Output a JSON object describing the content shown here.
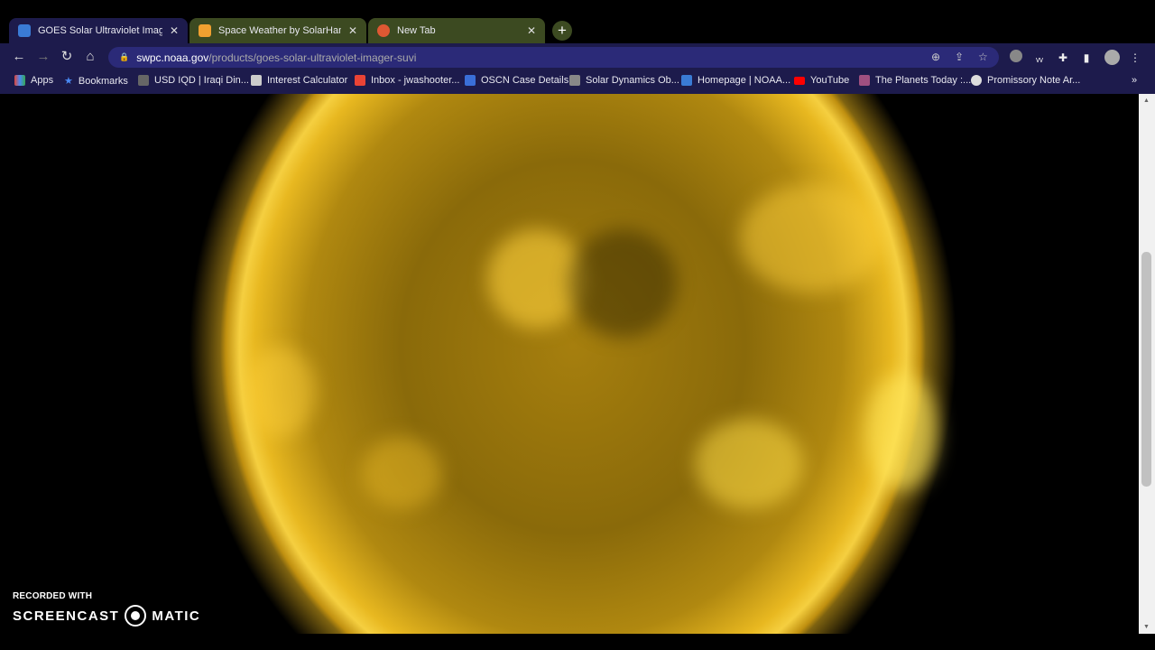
{
  "tabs": [
    {
      "title": "GOES Solar Ultraviolet Imager (S",
      "favicon": "noaa-icon",
      "color": "#3a7bd5",
      "active": true
    },
    {
      "title": "Space Weather by SolarHam",
      "favicon": "sun-icon",
      "color": "#f0a030",
      "active": false
    },
    {
      "title": "New Tab",
      "favicon": "duckduckgo-icon",
      "color": "#de5833",
      "active": false
    }
  ],
  "new_tab": "+",
  "close": "✕",
  "address": {
    "host": "swpc.noaa.gov",
    "path": "/products/goes-solar-ultraviolet-imager-suvi"
  },
  "bookmarks": [
    {
      "label": "Apps",
      "color": "#e0453a"
    },
    {
      "label": "Bookmarks",
      "color": "#4a8af4"
    },
    {
      "label": "USD IQD | Iraqi Din...",
      "color": "#666"
    },
    {
      "label": "Interest Calculator",
      "color": "#ccc"
    },
    {
      "label": "Inbox - jwashooter...",
      "color": "#ea4335"
    },
    {
      "label": "OSCN Case Details",
      "color": "#3a6fd8"
    },
    {
      "label": "Solar Dynamics Ob...",
      "color": "#888"
    },
    {
      "label": "Homepage | NOAA...",
      "color": "#3a7bd5"
    },
    {
      "label": "YouTube",
      "color": "#ff0000"
    },
    {
      "label": "The Planets Today :...",
      "color": "#a05080"
    },
    {
      "label": "Promissory Note Ar...",
      "color": "#ddd"
    }
  ],
  "more_bookmarks": "»",
  "watermark": {
    "line1": "RECORDED WITH",
    "left": "SCREENCAST",
    "right": "MATIC"
  }
}
